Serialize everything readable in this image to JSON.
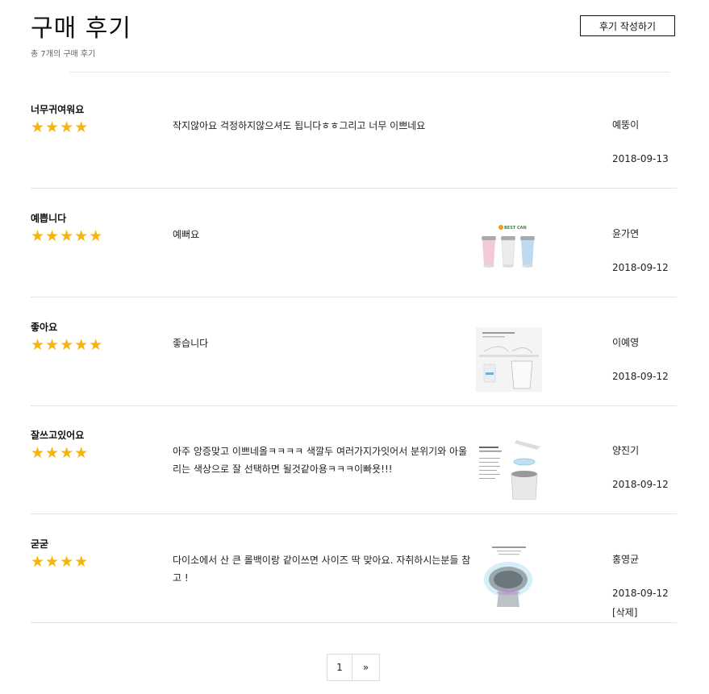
{
  "header": {
    "title": "구매 후기",
    "subtitle": "총 7개의 구매 후기",
    "write_button": "후기 작성하기"
  },
  "reviews": [
    {
      "title": "너무귀여워요",
      "rating": 4,
      "stars": "★★★★",
      "content": "작지않아요 걱정하지않으셔도 됩니다ㅎㅎ그리고 너무 이쁘네요",
      "author": "예뚱이",
      "date": "2018-09-13",
      "has_image": false
    },
    {
      "title": "예쁩니다",
      "rating": 5,
      "stars": "★★★★★",
      "content": "예뻐요",
      "author": "윤가연",
      "date": "2018-09-12",
      "has_image": true,
      "image_text": "BEST CAN"
    },
    {
      "title": "좋아요",
      "rating": 5,
      "stars": "★★★★★",
      "content": "좋습니다",
      "author": "이예영",
      "date": "2018-09-12",
      "has_image": true
    },
    {
      "title": "잘쓰고있어요",
      "rating": 4,
      "stars": "★★★★",
      "content": "아주 앙증맞고 이쁘네올ㅋㅋㅋㅋ 색깔두 여러가지가잇어서 분위기와 아울리는 색상으로 잘 선택하면 될것같아용ㅋㅋㅋ이빠욧!!!",
      "author": "양진기",
      "date": "2018-09-12",
      "has_image": true
    },
    {
      "title": "굳굳",
      "rating": 4,
      "stars": "★★★★",
      "content": "다이소에서 산 큰 롤백이랑 같이쓰면 사이즈 딱 맞아요. 자취하시는분들 참고 !",
      "author": "홍영균",
      "date": "2018-09-12",
      "has_image": true,
      "delete_label": "[삭제]"
    }
  ],
  "pagination": {
    "current": "1",
    "next": "»"
  },
  "colors": {
    "star": "#f5b50a",
    "divider": "#e3e3e3",
    "text": "#222222"
  }
}
